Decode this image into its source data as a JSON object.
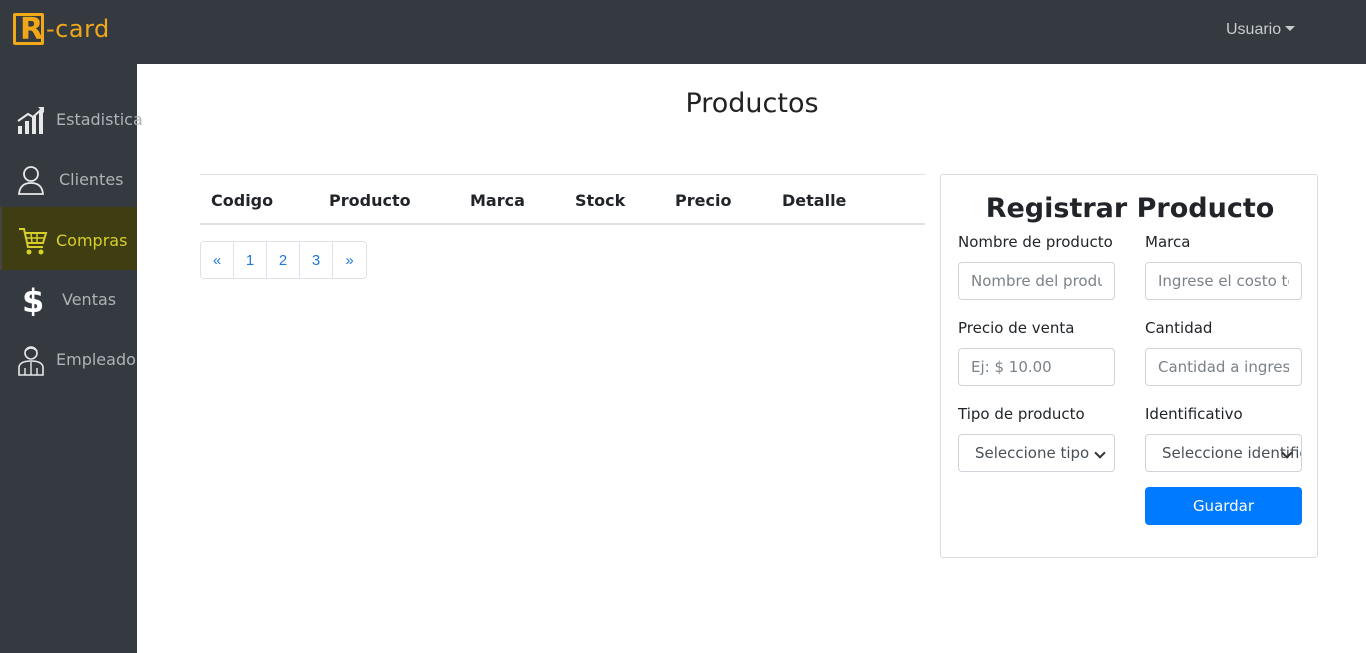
{
  "brand": {
    "logo_letter": "R",
    "logo_text": "-card",
    "color": "#f0a818"
  },
  "topbar": {
    "user_menu_label": "Usuario"
  },
  "sidebar": {
    "items": [
      {
        "label": "Estadistica",
        "icon": "bar-chart-icon"
      },
      {
        "label": "Clientes",
        "icon": "user-icon"
      },
      {
        "label": "Compras",
        "icon": "shopping-cart-icon",
        "active": true
      },
      {
        "label": "Ventas",
        "icon": "dollar-icon"
      },
      {
        "label": "Empleado",
        "icon": "employee-icon"
      }
    ],
    "active_color": "#d8cf2a"
  },
  "main": {
    "title": "Productos",
    "table": {
      "columns": [
        "Codigo",
        "Producto",
        "Marca",
        "Stock",
        "Precio",
        "Detalle"
      ],
      "rows": []
    },
    "pagination": [
      "«",
      "1",
      "2",
      "3",
      "»"
    ]
  },
  "form": {
    "title": "Registrar Producto",
    "nombre": {
      "label": "Nombre de producto",
      "placeholder": "Nombre del producto"
    },
    "marca": {
      "label": "Marca",
      "placeholder": "Ingrese el costo total"
    },
    "precio": {
      "label": "Precio de venta",
      "placeholder": "Ej: $ 10.00"
    },
    "cantidad": {
      "label": "Cantidad",
      "placeholder": "Cantidad a ingresar"
    },
    "tipo": {
      "label": "Tipo de producto",
      "selected": "Seleccione tipo"
    },
    "identificativo": {
      "label": "Identificativo",
      "selected": "Seleccione identificativo"
    },
    "submit_label": "Guardar",
    "submit_color": "#007bff"
  }
}
